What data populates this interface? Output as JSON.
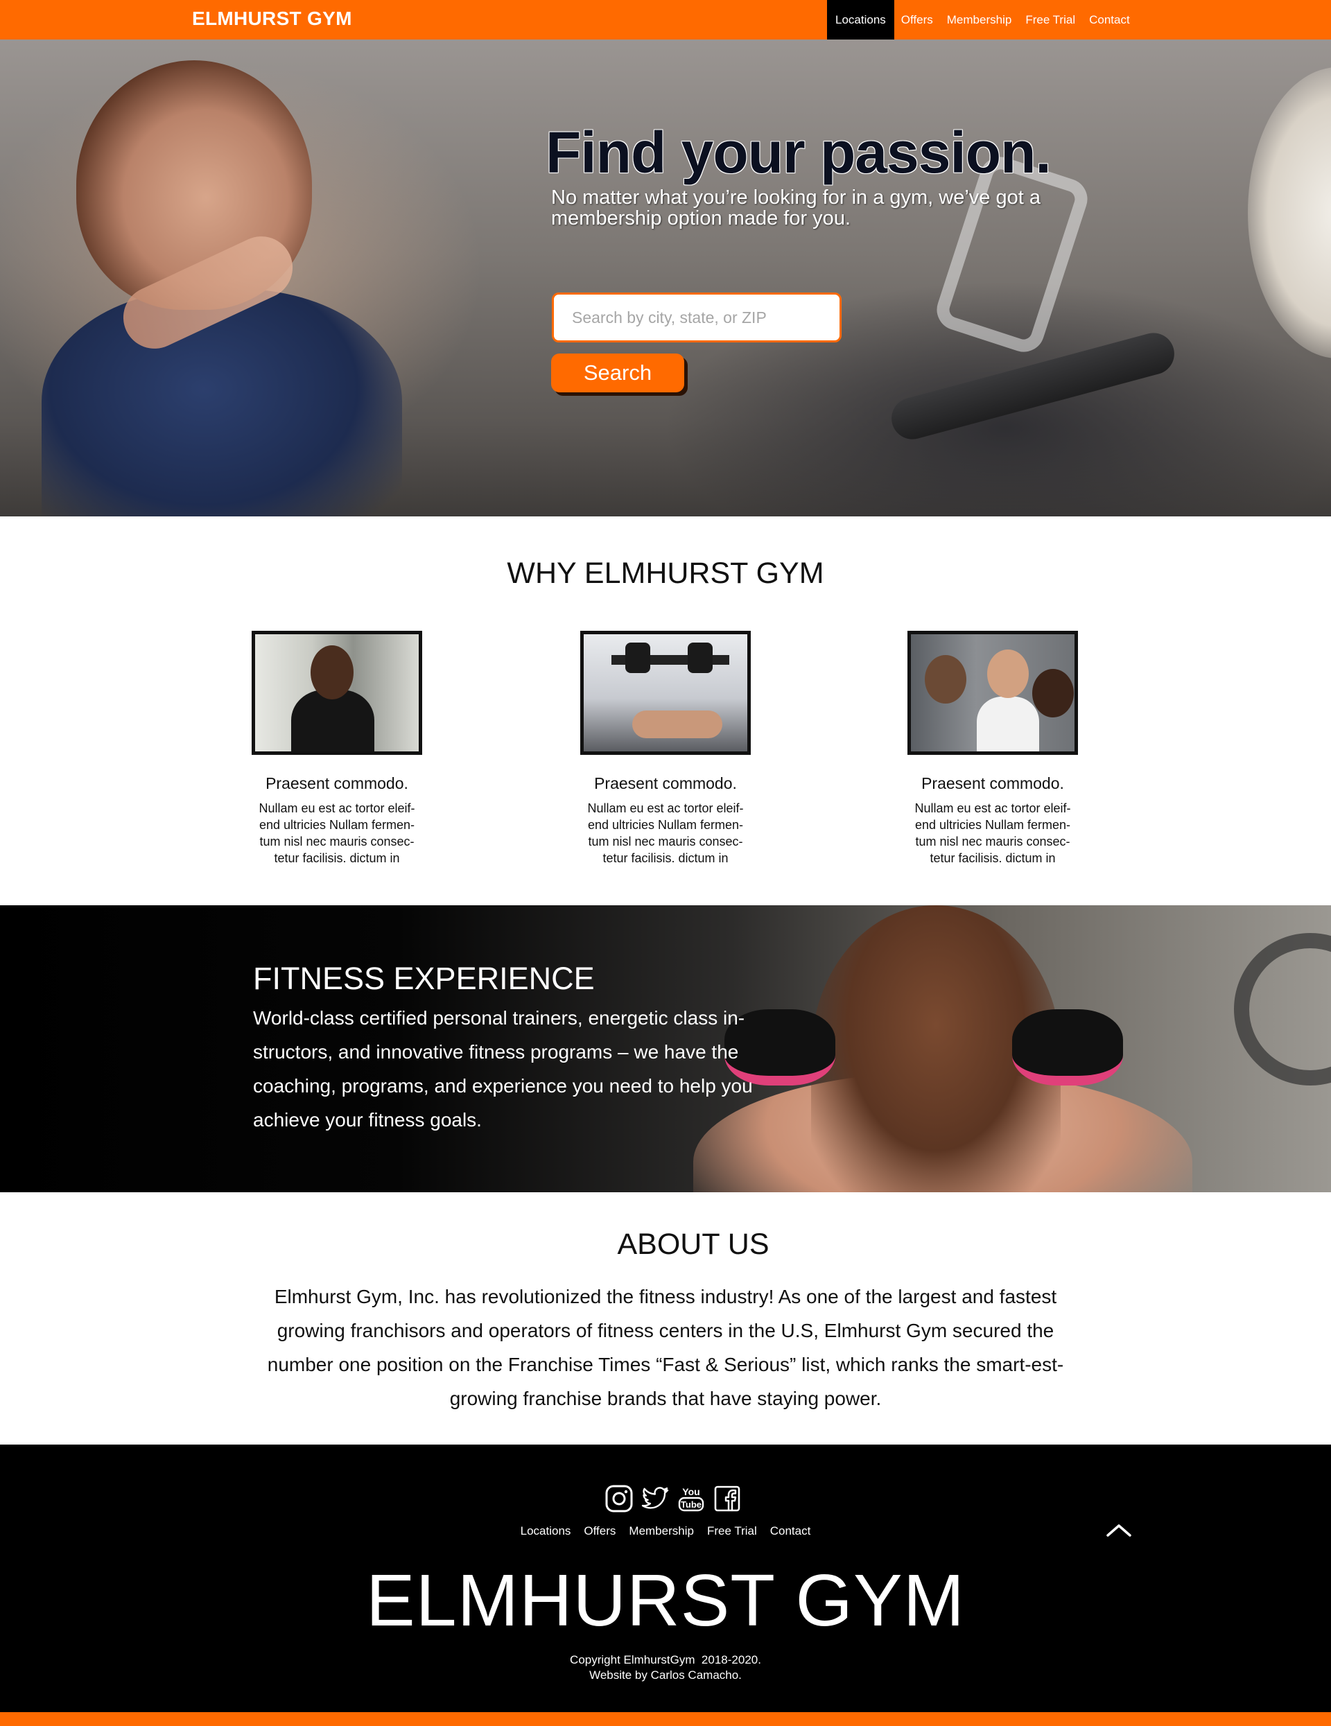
{
  "nav": {
    "brand": "ELMHURST GYM",
    "links": [
      "Locations",
      "Offers",
      "Membership",
      "Free Trial",
      "Contact"
    ],
    "active": "Locations"
  },
  "hero": {
    "title": "Find your passion.",
    "subtitle": "No matter what you’re looking for in a gym, we’ve got a membership option made for you.",
    "search_placeholder": "Search by city, state, or ZIP",
    "search_value": "",
    "search_button": "Search"
  },
  "why": {
    "title": "WHY ELMHURST GYM",
    "features": [
      {
        "title": "Praesent commodo.",
        "text": "Nullam eu est ac tortor eleif-end ultricies Nullam fermen-tum nisl nec mauris consec-tetur facilisis. dictum in"
      },
      {
        "title": "Praesent commodo.",
        "text": "Nullam eu est ac tortor eleif-end ultricies Nullam fermen-tum nisl nec mauris consec-tetur facilisis. dictum in"
      },
      {
        "title": "Praesent commodo.",
        "text": "Nullam eu est ac tortor eleif-end ultricies Nullam fermen-tum nisl nec mauris consec-tetur facilisis. dictum in"
      }
    ]
  },
  "fitness": {
    "title": "FITNESS EXPERIENCE",
    "text": "World-class certified personal trainers, energetic class in-structors, and innovative fitness programs – we have the coaching, programs, and experience you need to help you achieve your fitness goals."
  },
  "about": {
    "title": "ABOUT US",
    "text": "Elmhurst Gym, Inc. has revolutionized the fitness industry! As one of the largest and fastest growing franchisors and operators of fitness centers in the U.S, Elmhurst Gym secured the number one position on the Franchise Times “Fast & Serious” list, which ranks the smart-est-growing franchise brands that have staying power."
  },
  "footer": {
    "social": [
      "instagram-icon",
      "twitter-icon",
      "youtube-icon",
      "facebook-icon"
    ],
    "links": [
      "Locations",
      "Offers",
      "Membership",
      "Free Trial",
      "Contact"
    ],
    "brand": "ELMHURST GYM",
    "copyright_line1": "Copyright ElmhurstGym  2018-2020.",
    "copyright_line2": "Website by Carlos Camacho."
  },
  "colors": {
    "accent": "#ff6a00",
    "dark": "#000000",
    "text": "#111111"
  }
}
